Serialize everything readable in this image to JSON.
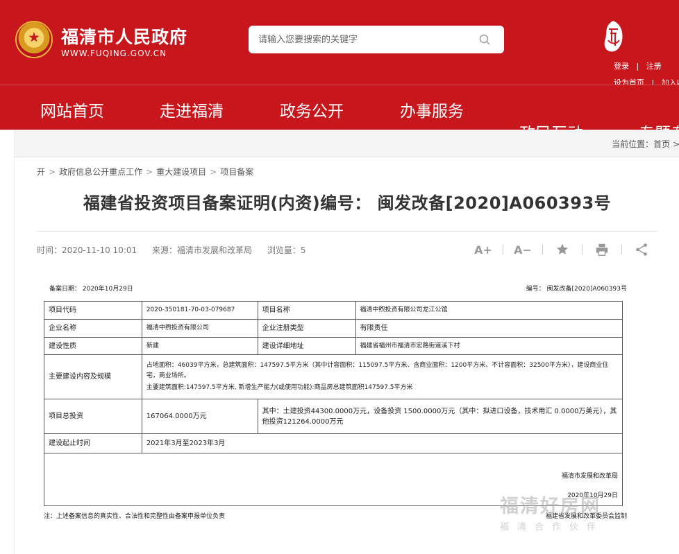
{
  "header": {
    "site_name": "福清市人民政府",
    "site_domain": "WWW.FUQING.GOV.CN",
    "search_placeholder": "请输入您要搜索的关键字",
    "login": "登录",
    "register": "注册",
    "set_home": "设为首页",
    "add_fav": "加入收",
    "fav_tail": "答"
  },
  "nav": {
    "items": [
      "网站首页",
      "走进福清",
      "政务公开",
      "办事服务",
      "政民互动",
      "专题专"
    ]
  },
  "location": {
    "label": "当前位置：",
    "home": "首页",
    "arrow": ">"
  },
  "breadcrumb": [
    "开",
    "政府信息公开重点工作",
    "重大建设项目",
    "项目备案"
  ],
  "article": {
    "title": "福建省投资项目备案证明(内资)编号： 闽发改备[2020]A060393号",
    "time": "时间：2020-11-10 10:01",
    "source": "来源：福清市发展和改革局",
    "views": "浏览量：5"
  },
  "tools": {
    "font_larger": "A+",
    "font_smaller": "A−"
  },
  "document": {
    "record_date": "备案日期： 2020年10月29日",
    "record_no": "编号： 闽发改备[2020]A060393号",
    "rows": {
      "code_label": "项目代码",
      "code_value": "2020-350181-70-03-079687",
      "name_label": "项目名称",
      "name_value": "福清中煦投资有限公司龙江公馆",
      "company_label": "企业名称",
      "company_value": "福清中煦投资有限公司",
      "reg_type_label": "企业注册类型",
      "reg_type_value": "有限责任",
      "nature_label": "建设性质",
      "nature_value": "新建",
      "address_label": "建设详细地址",
      "address_value": "福建省福州市福清市宏路街道溪下村",
      "content_label": "主要建设内容及规模",
      "content_value_1": "占地面积：46039平方米，总建筑面积：147597.5平方米（其中计容面积：115097.5平方米、含商业面积：1200平方米、不计容面积：32500平方米），建设商业住宅，商业场所。",
      "content_value_2": "主要建筑面积:147597.5平方米, 新增生产能力(或使用功能):商品房总建筑面积147597.5平方米",
      "invest_label": "项目总投资",
      "invest_value": "167064.0000万元",
      "invest_detail": "其中：土建投资44300.0000万元，设备投资 1500.0000万元（其中：拟进口设备，技术用汇 0.0000万美元），其他投资121264.0000万元",
      "period_label": "建设起止时间",
      "period_value": "2021年3月至2023年3月"
    },
    "sign_org": "福清市发展和改革局",
    "sign_date": "2020年10月29日",
    "note": "注：上述备案信息的真实性、合法性和完整性由备案申报单位负责",
    "supervision": "福建省发展和改革委员会监制"
  },
  "watermark": {
    "main": "福清好房网",
    "sub": "福清合作伙伴"
  }
}
